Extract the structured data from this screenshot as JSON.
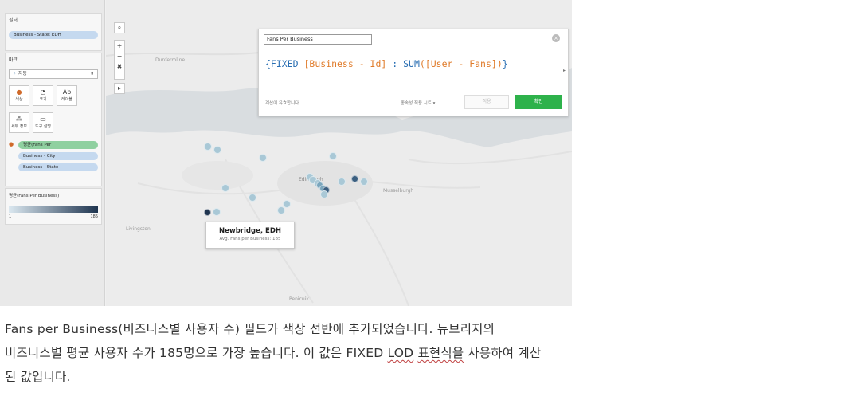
{
  "left_pane": {
    "filters_title": "필터",
    "filter_pill": "Business - State: EDH",
    "marks_title": "마크",
    "mark_type": "자동",
    "mark_buttons": [
      {
        "icon": "color-icon",
        "label": "색상"
      },
      {
        "icon": "size-icon",
        "label": "크기"
      },
      {
        "icon": "label-icon",
        "label": "레이블"
      },
      {
        "icon": "detail-icon",
        "label": "세부 정보"
      },
      {
        "icon": "tooltip-icon",
        "label": "도구 설명"
      }
    ],
    "mark_pills": [
      "평균(Fans Per",
      "Business - City",
      "Business - State"
    ],
    "legend_title": "평균(Fans Per Business)",
    "legend_min": "1",
    "legend_max": "185"
  },
  "map": {
    "places": [
      "Dunfermline",
      "Livingston",
      "Edinburgh",
      "Musselburgh",
      "Penicuik"
    ],
    "dots": [
      {
        "shade": "light"
      },
      {
        "shade": "light"
      },
      {
        "shade": "light"
      },
      {
        "shade": "light"
      },
      {
        "shade": "light"
      },
      {
        "shade": "light"
      },
      {
        "shade": "light"
      },
      {
        "shade": "medium"
      },
      {
        "shade": "medium"
      },
      {
        "shade": "dark"
      },
      {
        "shade": "dark"
      },
      {
        "shade": "light"
      },
      {
        "shade": "light"
      },
      {
        "shade": "light"
      },
      {
        "shade": "light"
      },
      {
        "shade": "light"
      },
      {
        "shade": "light"
      },
      {
        "shade": "light"
      },
      {
        "shade": "darkest"
      },
      {
        "shade": "light"
      }
    ]
  },
  "calc_dialog": {
    "name_value": "Fans Per Business",
    "formula_open": "{FIXED ",
    "formula_field": "[Business - Id]",
    "formula_colon": " : ",
    "formula_func": "SUM",
    "formula_arg": "([User - Fans])",
    "formula_close": "}",
    "status_text": "계산이 유효합니다.",
    "dependency_text": "종속성 적용 시트 ▾",
    "apply_label": "적용",
    "ok_label": "확인"
  },
  "tooltip": {
    "title": "Newbridge, EDH",
    "detail": "Avg. Fans per Business: 185"
  },
  "caption": {
    "line1": "Fans per Business(비즈니스별 사용자 수) 필드가 색상 선반에 추가되었습니다. 뉴브리지의",
    "line2_a": "비즈니스별 평균 사용자 수가 185명으로 가장 높습니다. 이 값은 FIXED ",
    "line2_lod": "LOD",
    "line2_b": " ",
    "line2_expr": "표현식을",
    "line2_c": " 사용하여 계산",
    "line3": "된 값입니다."
  },
  "colors": {
    "light": "#a9c8d6",
    "medium": "#7aa6bd",
    "dark": "#3b5f80",
    "darkest": "#1f3550",
    "ok_button": "#2eb24b",
    "formula_blue": "#2a6fb3",
    "formula_orange": "#e07b2a"
  }
}
